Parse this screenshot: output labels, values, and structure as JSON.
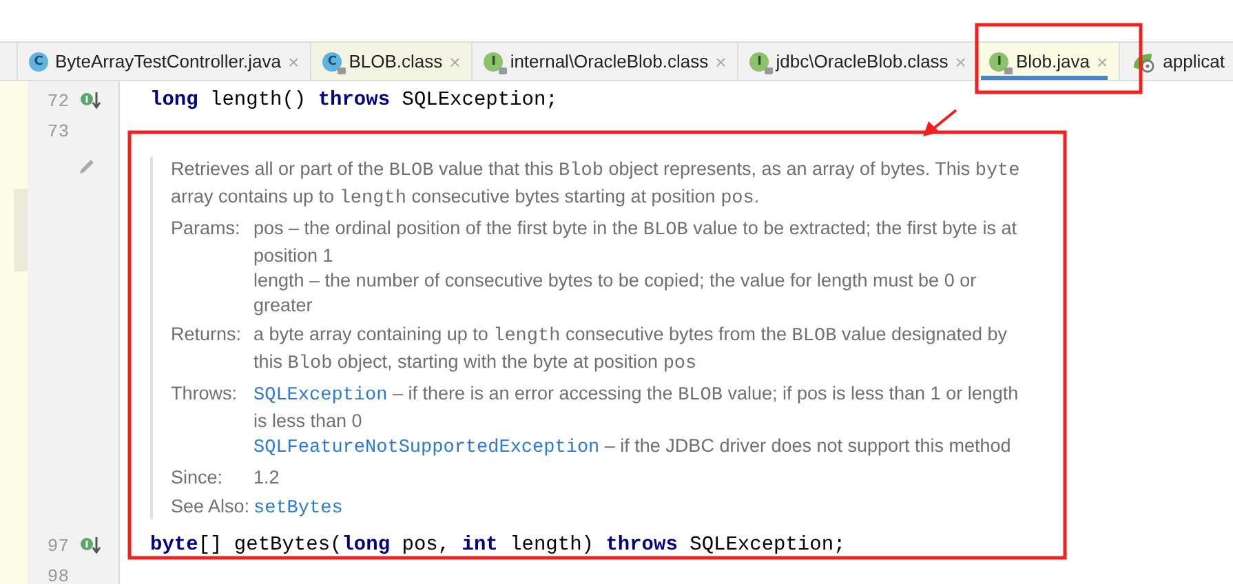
{
  "tabs": [
    {
      "label": "ByteArrayTestController.java",
      "kind": "class",
      "icon_letter": "C",
      "locked": false,
      "selected": false,
      "close": "×"
    },
    {
      "label": "BLOB.class",
      "kind": "class",
      "icon_letter": "C",
      "locked": true,
      "selected": false,
      "close": "×"
    },
    {
      "label": "internal\\OracleBlob.class",
      "kind": "interface",
      "icon_letter": "I",
      "locked": true,
      "selected": false,
      "close": "×"
    },
    {
      "label": "jdbc\\OracleBlob.class",
      "kind": "interface",
      "icon_letter": "I",
      "locked": true,
      "selected": false,
      "close": "×"
    },
    {
      "label": "Blob.java",
      "kind": "interface",
      "icon_letter": "I",
      "locked": true,
      "selected": true,
      "close": "×"
    },
    {
      "label": "applicat",
      "kind": "config",
      "selected": false
    }
  ],
  "code_before": [
    {
      "number": "72",
      "marker": true,
      "segments": [
        {
          "text": "long",
          "kind": "keyword"
        },
        {
          "text": " length() ",
          "kind": "plain"
        },
        {
          "text": "throws",
          "kind": "keyword"
        },
        {
          "text": " SQLException;",
          "kind": "plain"
        }
      ]
    },
    {
      "number": "73",
      "marker": false
    }
  ],
  "doc": {
    "description": [
      {
        "text": "Retrieves all or part of the ",
        "kind": "plain"
      },
      {
        "text": "BLOB",
        "kind": "code"
      },
      {
        "text": " value that this ",
        "kind": "plain"
      },
      {
        "text": "Blob",
        "kind": "code"
      },
      {
        "text": " object represents, as an array of bytes. This ",
        "kind": "plain"
      },
      {
        "text": "byte",
        "kind": "code"
      },
      {
        "text": " array contains up to ",
        "kind": "plain"
      },
      {
        "text": "length",
        "kind": "code"
      },
      {
        "text": " consecutive bytes starting at position ",
        "kind": "plain"
      },
      {
        "text": "pos",
        "kind": "code"
      },
      {
        "text": ".",
        "kind": "plain"
      }
    ],
    "sections": [
      {
        "label": "Params:",
        "paragraphs": [
          [
            {
              "text": "pos – the ordinal position of the first byte in the ",
              "kind": "plain"
            },
            {
              "text": "BLOB",
              "kind": "code"
            },
            {
              "text": " value to be extracted; the first byte is at position 1",
              "kind": "plain"
            }
          ],
          [
            {
              "text": "length – the number of consecutive bytes to be copied; the value for length must be 0 or greater",
              "kind": "plain"
            }
          ]
        ]
      },
      {
        "label": "Returns:",
        "paragraphs": [
          [
            {
              "text": "a byte array containing up to ",
              "kind": "plain"
            },
            {
              "text": "length",
              "kind": "code"
            },
            {
              "text": " consecutive bytes from the ",
              "kind": "plain"
            },
            {
              "text": "BLOB",
              "kind": "code"
            },
            {
              "text": " value designated by this ",
              "kind": "plain"
            },
            {
              "text": "Blob",
              "kind": "code"
            },
            {
              "text": " object, starting with the byte at position ",
              "kind": "plain"
            },
            {
              "text": "pos",
              "kind": "code"
            }
          ]
        ]
      },
      {
        "label": "Throws:",
        "paragraphs": [
          [
            {
              "text": "SQLException",
              "kind": "link"
            },
            {
              "text": " – if there is an error accessing the ",
              "kind": "plain"
            },
            {
              "text": "BLOB",
              "kind": "code"
            },
            {
              "text": " value; if pos is less than 1 or length is less than 0",
              "kind": "plain"
            }
          ],
          [
            {
              "text": "SQLFeatureNotSupportedException",
              "kind": "link"
            },
            {
              "text": " – if the JDBC driver does not support this method",
              "kind": "plain"
            }
          ]
        ]
      },
      {
        "label": "Since:",
        "paragraphs": [
          [
            {
              "text": "1.2",
              "kind": "plain"
            }
          ]
        ]
      },
      {
        "label": "See Also:",
        "paragraphs": [
          [
            {
              "text": "setBytes",
              "kind": "link"
            }
          ]
        ]
      }
    ]
  },
  "code_after": [
    {
      "number": "97",
      "marker": true,
      "segments": [
        {
          "text": "byte",
          "kind": "keyword"
        },
        {
          "text": "[] getBytes(",
          "kind": "plain"
        },
        {
          "text": "long",
          "kind": "keyword"
        },
        {
          "text": " pos, ",
          "kind": "plain"
        },
        {
          "text": "int",
          "kind": "keyword"
        },
        {
          "text": " length) ",
          "kind": "plain"
        },
        {
          "text": "throws",
          "kind": "keyword"
        },
        {
          "text": " SQLException;",
          "kind": "plain"
        }
      ]
    },
    {
      "number": "98",
      "marker": false
    }
  ]
}
